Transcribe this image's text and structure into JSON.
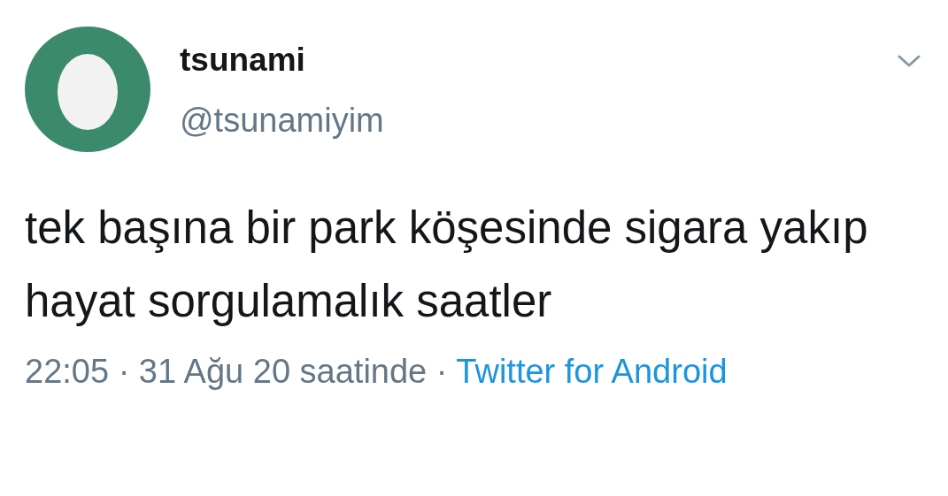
{
  "author": {
    "name": "tsunami",
    "handle": "@tsunamiyim"
  },
  "tweet": {
    "text": "tek başına bir park köşesinde sigara yakıp hayat sorgulamalık saatler"
  },
  "meta": {
    "timestamp": "22:05 · 31 Ağu 20 saatinde ·",
    "source": "Twitter for Android"
  }
}
